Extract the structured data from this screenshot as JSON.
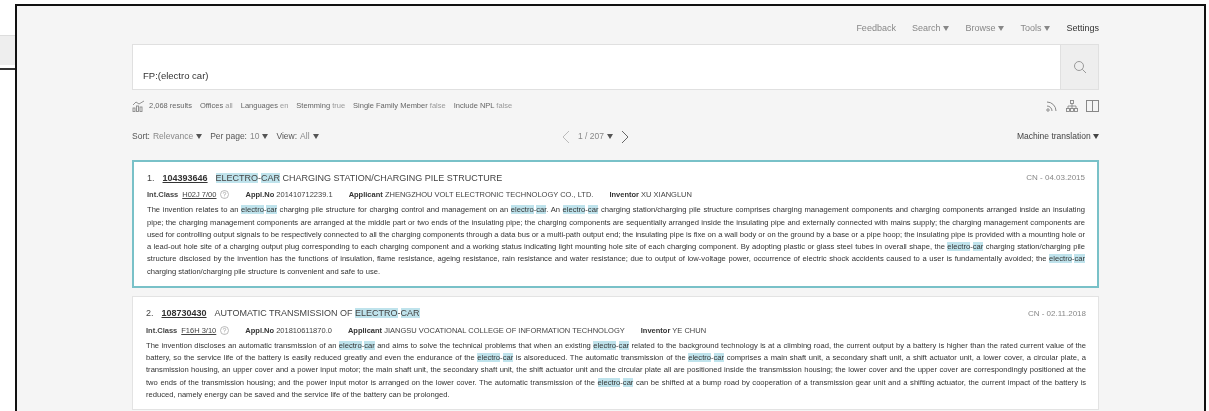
{
  "nav": [
    {
      "label": "Feedback",
      "dropdown": false,
      "selected": false
    },
    {
      "label": "Search",
      "dropdown": true,
      "selected": false
    },
    {
      "label": "Browse",
      "dropdown": true,
      "selected": false
    },
    {
      "label": "Tools",
      "dropdown": true,
      "selected": false
    },
    {
      "label": "Settings",
      "dropdown": false,
      "selected": true
    }
  ],
  "search": {
    "value": "FP:(electro car)"
  },
  "stats": {
    "results": "2,068 results",
    "filters": [
      {
        "label": "Offices",
        "value": "all"
      },
      {
        "label": "Languages",
        "value": "en"
      },
      {
        "label": "Stemming",
        "value": "true"
      },
      {
        "label": "Single Family Member",
        "value": "false"
      },
      {
        "label": "Include NPL",
        "value": "false"
      }
    ]
  },
  "controls": [
    {
      "label": "Sort:",
      "value": "Relevance"
    },
    {
      "label": "Per page:",
      "value": "10"
    },
    {
      "label": "View:",
      "value": "All"
    }
  ],
  "pager": {
    "page": "1 / 207"
  },
  "translation": "Machine translation",
  "results": [
    {
      "number": "1.",
      "id": "104393646",
      "selected": true,
      "title": [
        {
          "text": "ELECTRO",
          "highlight": true
        },
        {
          "text": "-",
          "highlight": false
        },
        {
          "text": "CAR",
          "highlight": true
        },
        {
          "text": " CHARGING STATION/CHARGING PILE STRUCTURE",
          "highlight": false
        }
      ],
      "date": "CN - 04.03.2015",
      "fields": [
        {
          "kind": "class",
          "label": "Int.Class",
          "value": "H02J 7/00"
        },
        {
          "kind": "text",
          "label": "Appl.No",
          "value": "201410712239.1"
        },
        {
          "kind": "text",
          "label": "Applicant",
          "value": "ZHENGZHOU VOLT ELECTRONIC TECHNOLOGY CO., LTD."
        },
        {
          "kind": "text",
          "label": "Inventor",
          "value": "XU XIANGLUN"
        }
      ],
      "abstract": [
        {
          "text": "The invention relates to an ",
          "highlight": false
        },
        {
          "text": "electro",
          "highlight": true
        },
        {
          "text": "-",
          "highlight": false
        },
        {
          "text": "car",
          "highlight": true
        },
        {
          "text": " charging pile structure for charging control and management on an ",
          "highlight": false
        },
        {
          "text": "electro",
          "highlight": true
        },
        {
          "text": "-",
          "highlight": false
        },
        {
          "text": "car",
          "highlight": true
        },
        {
          "text": ". An ",
          "highlight": false
        },
        {
          "text": "electro",
          "highlight": true
        },
        {
          "text": "-",
          "highlight": false
        },
        {
          "text": "car",
          "highlight": true
        },
        {
          "text": " charging station/charging pile structure comprises charging management components and charging components arranged inside an insulating pipe; the charging management components are arranged at the middle part or two ends of the insulating pipe; the charging components are sequentially arranged inside the insulating pipe and externally connected with mains supply; the charging management components are used for controlling output signals to be respectively connected to all the charging components through a data bus or a multi-path output end; the insulating pipe is fixe on a wall body or on the ground by a base or a pipe hoop; the insulating pipe is provided with a mounting hole or a lead-out hole site of a charging output plug corresponding to each charging component and a working status indicating light mounting hole site of each charging component. By adopting plastic or glass steel tubes in overall shape, the ",
          "highlight": false
        },
        {
          "text": "electro",
          "highlight": true
        },
        {
          "text": "-",
          "highlight": false
        },
        {
          "text": "car",
          "highlight": true
        },
        {
          "text": " charging station/charging pile structure disclosed by the invention has the functions of insulation, flame resistance, ageing resistance, rain resistance and water resistance; due to output of low-voltage power, occurrence of electric shock accidents caused to a user is fundamentally avoided; the ",
          "highlight": false
        },
        {
          "text": "electro",
          "highlight": true
        },
        {
          "text": "-",
          "highlight": false
        },
        {
          "text": "car",
          "highlight": true
        },
        {
          "text": " charging station/charging pile structure is convenient and safe to use.",
          "highlight": false
        }
      ]
    },
    {
      "number": "2.",
      "id": "108730430",
      "selected": false,
      "title": [
        {
          "text": "AUTOMATIC TRANSMISSION OF ",
          "highlight": false
        },
        {
          "text": "ELECTRO",
          "highlight": true
        },
        {
          "text": "-",
          "highlight": false
        },
        {
          "text": "CAR",
          "highlight": true
        }
      ],
      "date": "CN - 02.11.2018",
      "fields": [
        {
          "kind": "class",
          "label": "Int.Class",
          "value": "F16H 3/10"
        },
        {
          "kind": "text",
          "label": "Appl.No",
          "value": "201810611870.0"
        },
        {
          "kind": "text",
          "label": "Applicant",
          "value": "JIANGSU VOCATIONAL COLLEGE OF INFORMATION TECHNOLOGY"
        },
        {
          "kind": "text",
          "label": "Inventor",
          "value": "YE CHUN"
        }
      ],
      "abstract": [
        {
          "text": "The invention discloses an automatic transmission of an ",
          "highlight": false
        },
        {
          "text": "electro",
          "highlight": true
        },
        {
          "text": "-",
          "highlight": false
        },
        {
          "text": "car",
          "highlight": true
        },
        {
          "text": " and aims to solve the technical problems that when an existing ",
          "highlight": false
        },
        {
          "text": "electro",
          "highlight": true
        },
        {
          "text": "-",
          "highlight": false
        },
        {
          "text": "car",
          "highlight": true
        },
        {
          "text": " related to the background technology is at a climbing road, the current output by a battery is higher than the rated current value of the battery, so the service life of the battery is easily reduced greatly and even the endurance of the ",
          "highlight": false
        },
        {
          "text": "electro",
          "highlight": true
        },
        {
          "text": "-",
          "highlight": false
        },
        {
          "text": "car",
          "highlight": true
        },
        {
          "text": " is alsoreduced. The automatic transmission of the ",
          "highlight": false
        },
        {
          "text": "electro",
          "highlight": true
        },
        {
          "text": "-",
          "highlight": false
        },
        {
          "text": "car",
          "highlight": true
        },
        {
          "text": " comprises a main shaft unit, a secondary shaft unit, a shift actuator unit, a lower cover, a circular plate, a transmission housing, an upper cover and a power input motor; the main shaft unit, the secondary shaft unit, the shift actuator unit and the circular plate all are positioned inside the transmission housing; the lower cover and the upper cover are correspondingly positioned at the two ends of the transmission housing; and the power input motor is arranged on the lower cover. The automatic transmission of the ",
          "highlight": false
        },
        {
          "text": "electro",
          "highlight": true
        },
        {
          "text": "-",
          "highlight": false
        },
        {
          "text": "car",
          "highlight": true
        },
        {
          "text": " can be shifted at a bump road by cooperation of a transmission gear unit and a shifting actuator, the current impact of the battery is reduced, namely energy can be saved and the service life of the battery can be prolonged.",
          "highlight": false
        }
      ]
    }
  ]
}
